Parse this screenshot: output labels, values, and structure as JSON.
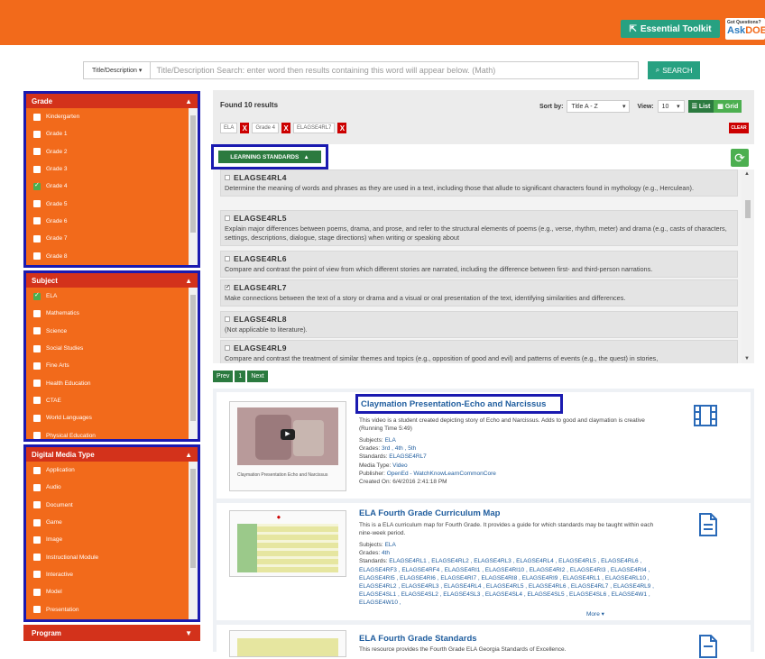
{
  "header": {
    "toolkit_label": "Essential Toolkit",
    "ask_small": "Got Questions?",
    "ask_a": "Ask",
    "ask_b": "DOE"
  },
  "search": {
    "mode_label": "Title/Description",
    "placeholder": "Title/Description Search:  enter word then results containing this word will appear below. (Math)",
    "button_label": "SEARCH"
  },
  "facets": {
    "grade": {
      "title": "Grade",
      "items": [
        {
          "label": "Kindergarten",
          "checked": false
        },
        {
          "label": "Grade 1",
          "checked": false
        },
        {
          "label": "Grade 2",
          "checked": false
        },
        {
          "label": "Grade 3",
          "checked": false
        },
        {
          "label": "Grade 4",
          "checked": true
        },
        {
          "label": "Grade 5",
          "checked": false
        },
        {
          "label": "Grade 6",
          "checked": false
        },
        {
          "label": "Grade 7",
          "checked": false
        },
        {
          "label": "Grade 8",
          "checked": false
        }
      ]
    },
    "subject": {
      "title": "Subject",
      "items": [
        {
          "label": "ELA",
          "checked": true
        },
        {
          "label": "Mathematics",
          "checked": false
        },
        {
          "label": "Science",
          "checked": false
        },
        {
          "label": "Social Studies",
          "checked": false
        },
        {
          "label": "Fine Arts",
          "checked": false
        },
        {
          "label": "Health Education",
          "checked": false
        },
        {
          "label": "CTAE",
          "checked": false
        },
        {
          "label": "World Languages",
          "checked": false
        },
        {
          "label": "Physical Education",
          "checked": false
        }
      ]
    },
    "media": {
      "title": "Digital Media Type",
      "items": [
        {
          "label": "Application",
          "checked": false
        },
        {
          "label": "Audio",
          "checked": false
        },
        {
          "label": "Document",
          "checked": false
        },
        {
          "label": "Game",
          "checked": false
        },
        {
          "label": "Image",
          "checked": false
        },
        {
          "label": "Instructional Module",
          "checked": false
        },
        {
          "label": "Interactive",
          "checked": false
        },
        {
          "label": "Model",
          "checked": false
        },
        {
          "label": "Presentation",
          "checked": false
        }
      ]
    },
    "program_title": "Program"
  },
  "results_bar": {
    "found": "Found 10 results",
    "sort_label": "Sort by:",
    "sort_value": "Title A - Z",
    "view_label": "View:",
    "view_value": "10",
    "list_label": "List",
    "grid_label": "Grid",
    "chips": [
      "ELA",
      "Grade 4",
      "ELAGSE4RL7"
    ],
    "clear_label": "CLEAR"
  },
  "learning_standards": {
    "button_label": "LEARNING STANDARDS",
    "items": [
      {
        "code": "ELAGSE4RL4",
        "checked": false,
        "desc": "Determine the meaning of words and phrases as they are used in a text, including those that allude to significant characters found in mythology (e.g., Herculean)."
      },
      {
        "code": "ELAGSE4RL5",
        "checked": false,
        "desc": "Explain major differences between poems, drama, and prose, and refer to the structural elements of poems (e.g., verse, rhythm, meter) and drama (e.g., casts of characters, settings, descriptions, dialogue, stage directions) when writing or speaking about"
      },
      {
        "code": "ELAGSE4RL6",
        "checked": false,
        "desc": "Compare and contrast the point of view from which different stories are narrated, including the difference between first- and third-person narrations."
      },
      {
        "code": "ELAGSE4RL7",
        "checked": true,
        "desc": "Make connections between the text of a story or drama and a visual or oral presentation of the text, identifying similarities and differences."
      },
      {
        "code": "ELAGSE4RL8",
        "checked": false,
        "desc": "(Not applicable to literature)."
      },
      {
        "code": "ELAGSE4RL9",
        "checked": false,
        "desc": "Compare and contrast the treatment of similar themes and topics (e.g., opposition of good and evil) and patterns of events (e.g., the quest) in stories,"
      }
    ]
  },
  "pager": {
    "prev": "Prev",
    "page": "1",
    "next": "Next"
  },
  "results": [
    {
      "title": "Claymation Presentation-Echo and Narcissus",
      "desc": "This video is a student created depicting story of Echo and Narcissus. Adds to good and claymation is creative (Running Time 5:49)",
      "thumb_caption": "Claymation Presentation Echo and Narcissus",
      "subjects_label": "Subjects:",
      "subjects": "ELA",
      "grades_label": "Grades:",
      "grades": "3rd , 4th , 5th",
      "standards_label": "Standards:",
      "standards": "ELAGSE4RL7",
      "media_label": "Media Type:",
      "media": "Video",
      "publisher_label": "Publisher:",
      "publisher": "OpenEd - WatchKnowLearnCommonCore",
      "created_label": "Created On:",
      "created": "6/4/2016 2:41:18 PM",
      "icon": "film-icon"
    },
    {
      "title": "ELA Fourth Grade Curriculum Map",
      "desc": "This is a ELA curriculum map for Fourth Grade. It provides a guide for which standards may be taught within each nine-week period.",
      "subjects_label": "Subjects:",
      "subjects": "ELA",
      "grades_label": "Grades:",
      "grades": "4th",
      "standards_label": "Standards:",
      "standards": "ELAGSE4RL1 , ELAGSE4RL2 , ELAGSE4RL3 , ELAGSE4RL4 , ELAGSE4RL5 , ELAGSE4RL6 , ELAGSE4RF3 , ELAGSE4RF4 , ELAGSE4RI1 , ELAGSE4RI10 , ELAGSE4RI2 , ELAGSE4RI3 , ELAGSE4RI4 , ELAGSE4RI5 , ELAGSE4RI6 , ELAGSE4RI7 , ELAGSE4RI8 , ELAGSE4RI9 , ELAGSE4RL1 , ELAGSE4RL10 , ELAGSE4RL2 , ELAGSE4RL3 , ELAGSE4RL4 , ELAGSE4RL5 , ELAGSE4RL6 , ELAGSE4RL7 , ELAGSE4RL9 , ELAGSE4SL1 , ELAGSE4SL2 , ELAGSE4SL3 , ELAGSE4SL4 , ELAGSE4SL5 , ELAGSE4SL6 , ELAGSE4W1 , ELAGSE4W10 ,",
      "more": "More ▾",
      "icon": "document-icon"
    },
    {
      "title": "ELA Fourth Grade Standards",
      "desc": "This resource provides the Fourth Grade ELA Georgia Standards of Excellence.",
      "icon": "document-icon"
    }
  ],
  "colors": {
    "orange": "#f26a1b",
    "red": "#d3321b",
    "green": "#27a181",
    "highlight": "#1a1ab0",
    "link": "#1f5d9e"
  }
}
